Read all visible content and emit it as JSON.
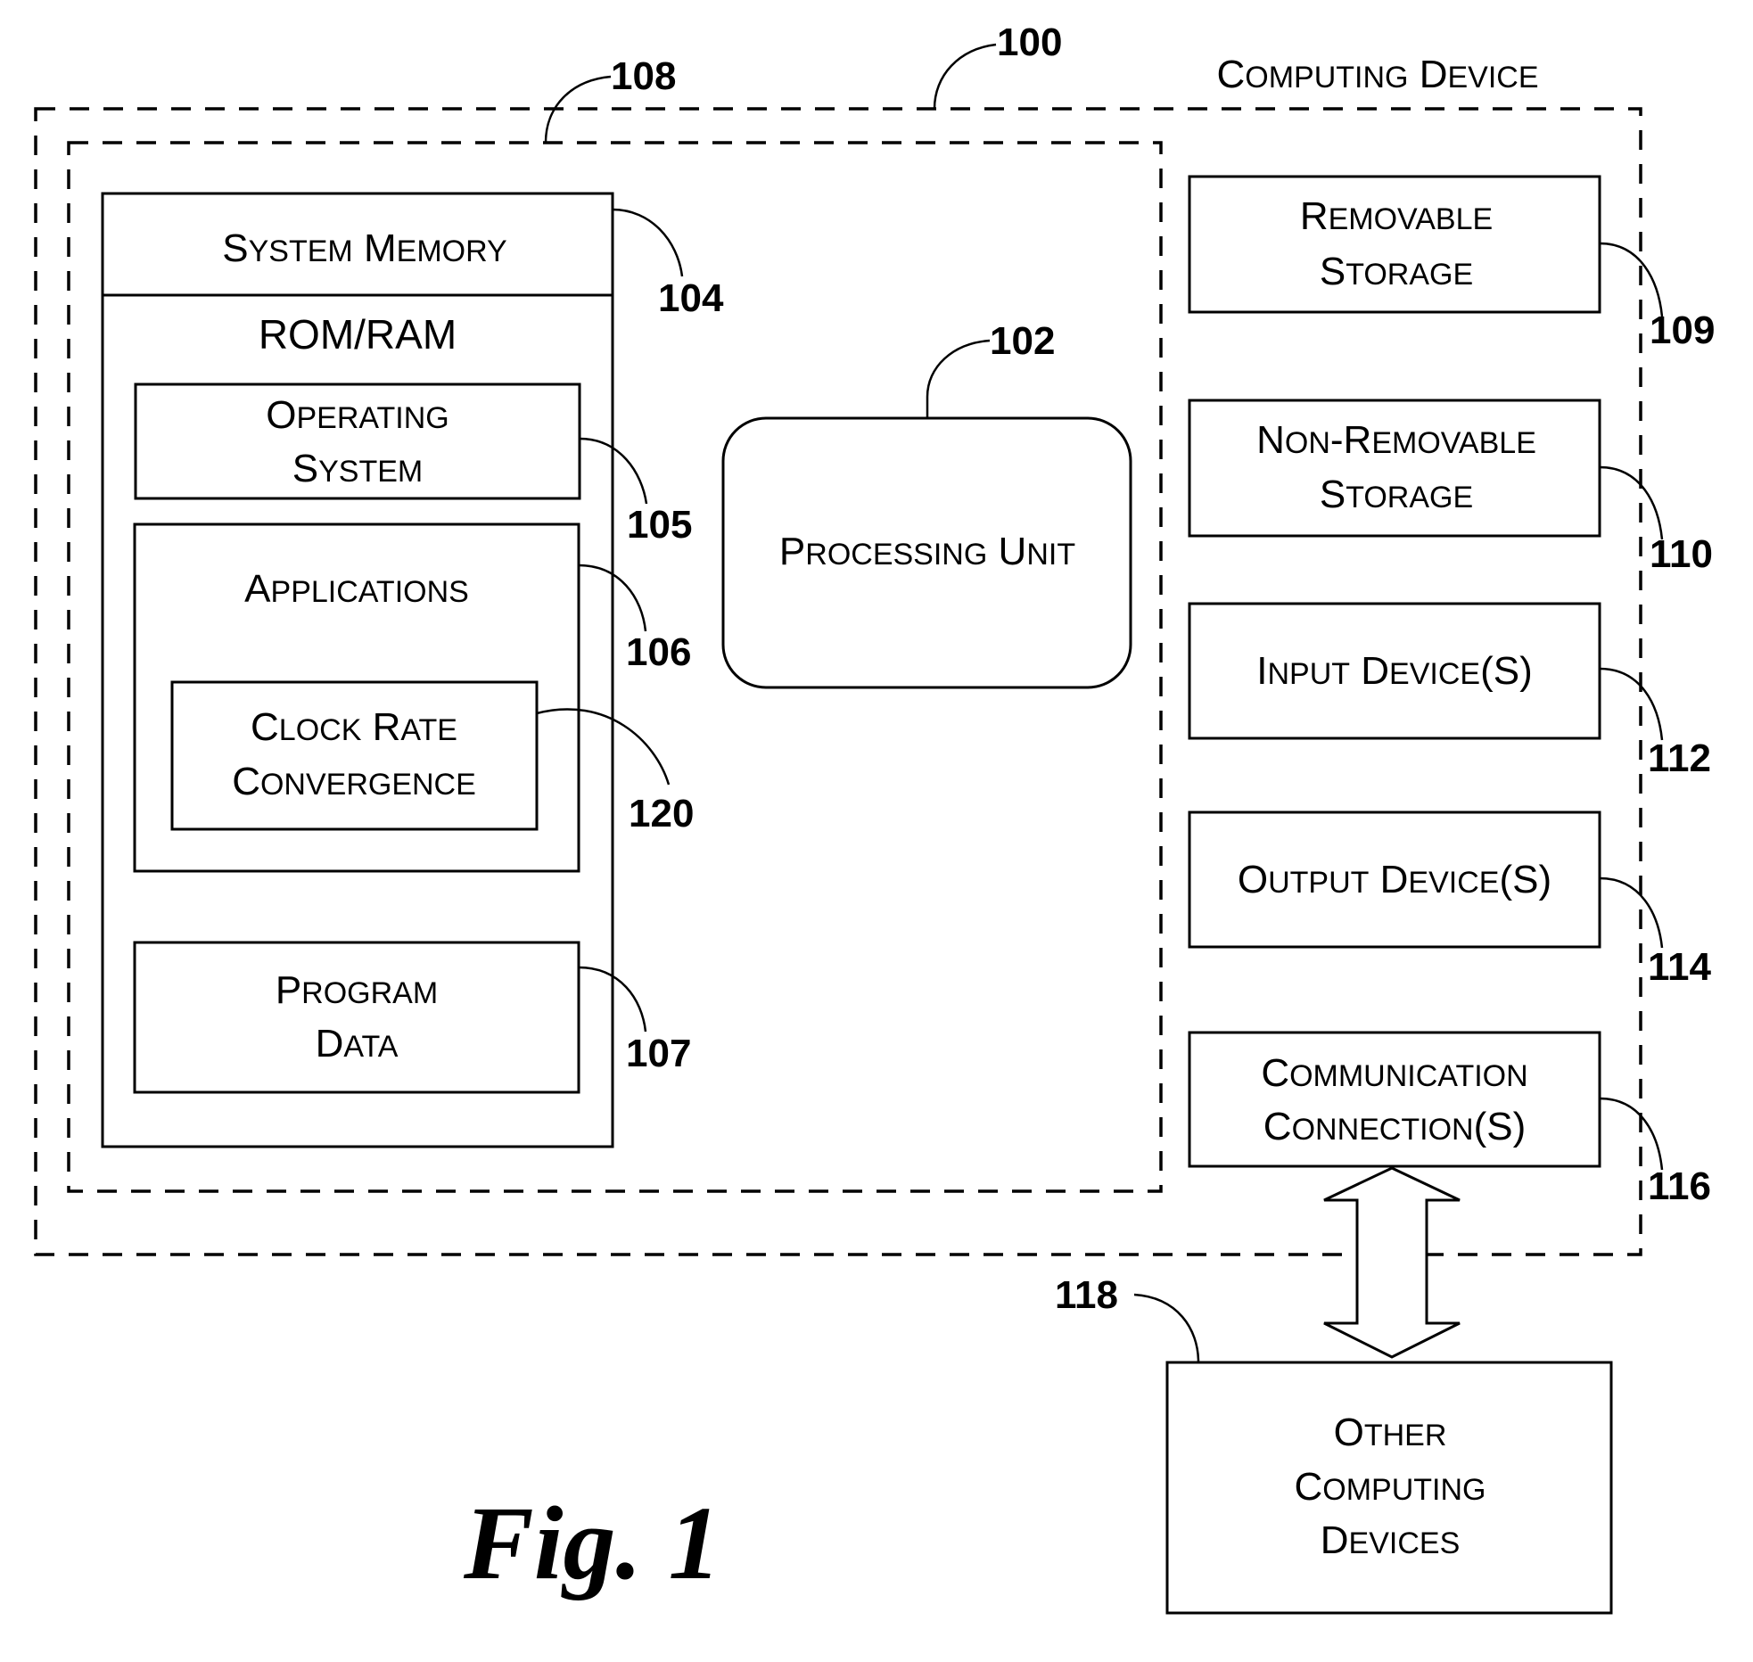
{
  "figure": {
    "caption": "Fig. 1",
    "title": "Computing Device"
  },
  "components": {
    "computing_device": {
      "ref": "100",
      "label": [
        "Computing Device"
      ]
    },
    "basic_config": {
      "ref": "108"
    },
    "system_memory": {
      "ref": "104",
      "label": [
        "System Memory"
      ],
      "sublabel": "ROM/RAM"
    },
    "operating_system": {
      "ref": "105",
      "label": [
        "Operating",
        "System"
      ]
    },
    "applications": {
      "ref": "106",
      "label": [
        "Applications"
      ]
    },
    "clock_rate_convergence": {
      "ref": "120",
      "label": [
        "Clock Rate",
        "Convergence"
      ]
    },
    "program_data": {
      "ref": "107",
      "label": [
        "Program",
        "Data"
      ]
    },
    "processing_unit": {
      "ref": "102",
      "label": [
        "Processing Unit"
      ]
    },
    "removable_storage": {
      "ref": "109",
      "label": [
        "Removable",
        "Storage"
      ]
    },
    "non_removable_storage": {
      "ref": "110",
      "label": [
        "Non-Removable",
        "Storage"
      ]
    },
    "input_devices": {
      "ref": "112",
      "label": [
        "Input Device(s)"
      ]
    },
    "output_devices": {
      "ref": "114",
      "label": [
        "Output Device(s)"
      ]
    },
    "communication_connections": {
      "ref": "116",
      "label": [
        "Communication",
        "Connection(s)"
      ]
    },
    "other_computing_devices": {
      "ref": "118",
      "label": [
        "Other",
        "Computing",
        "Devices"
      ]
    }
  },
  "connections": [
    {
      "from": "communication_connections",
      "to": "other_computing_devices",
      "type": "bidirectional-arrow"
    }
  ]
}
